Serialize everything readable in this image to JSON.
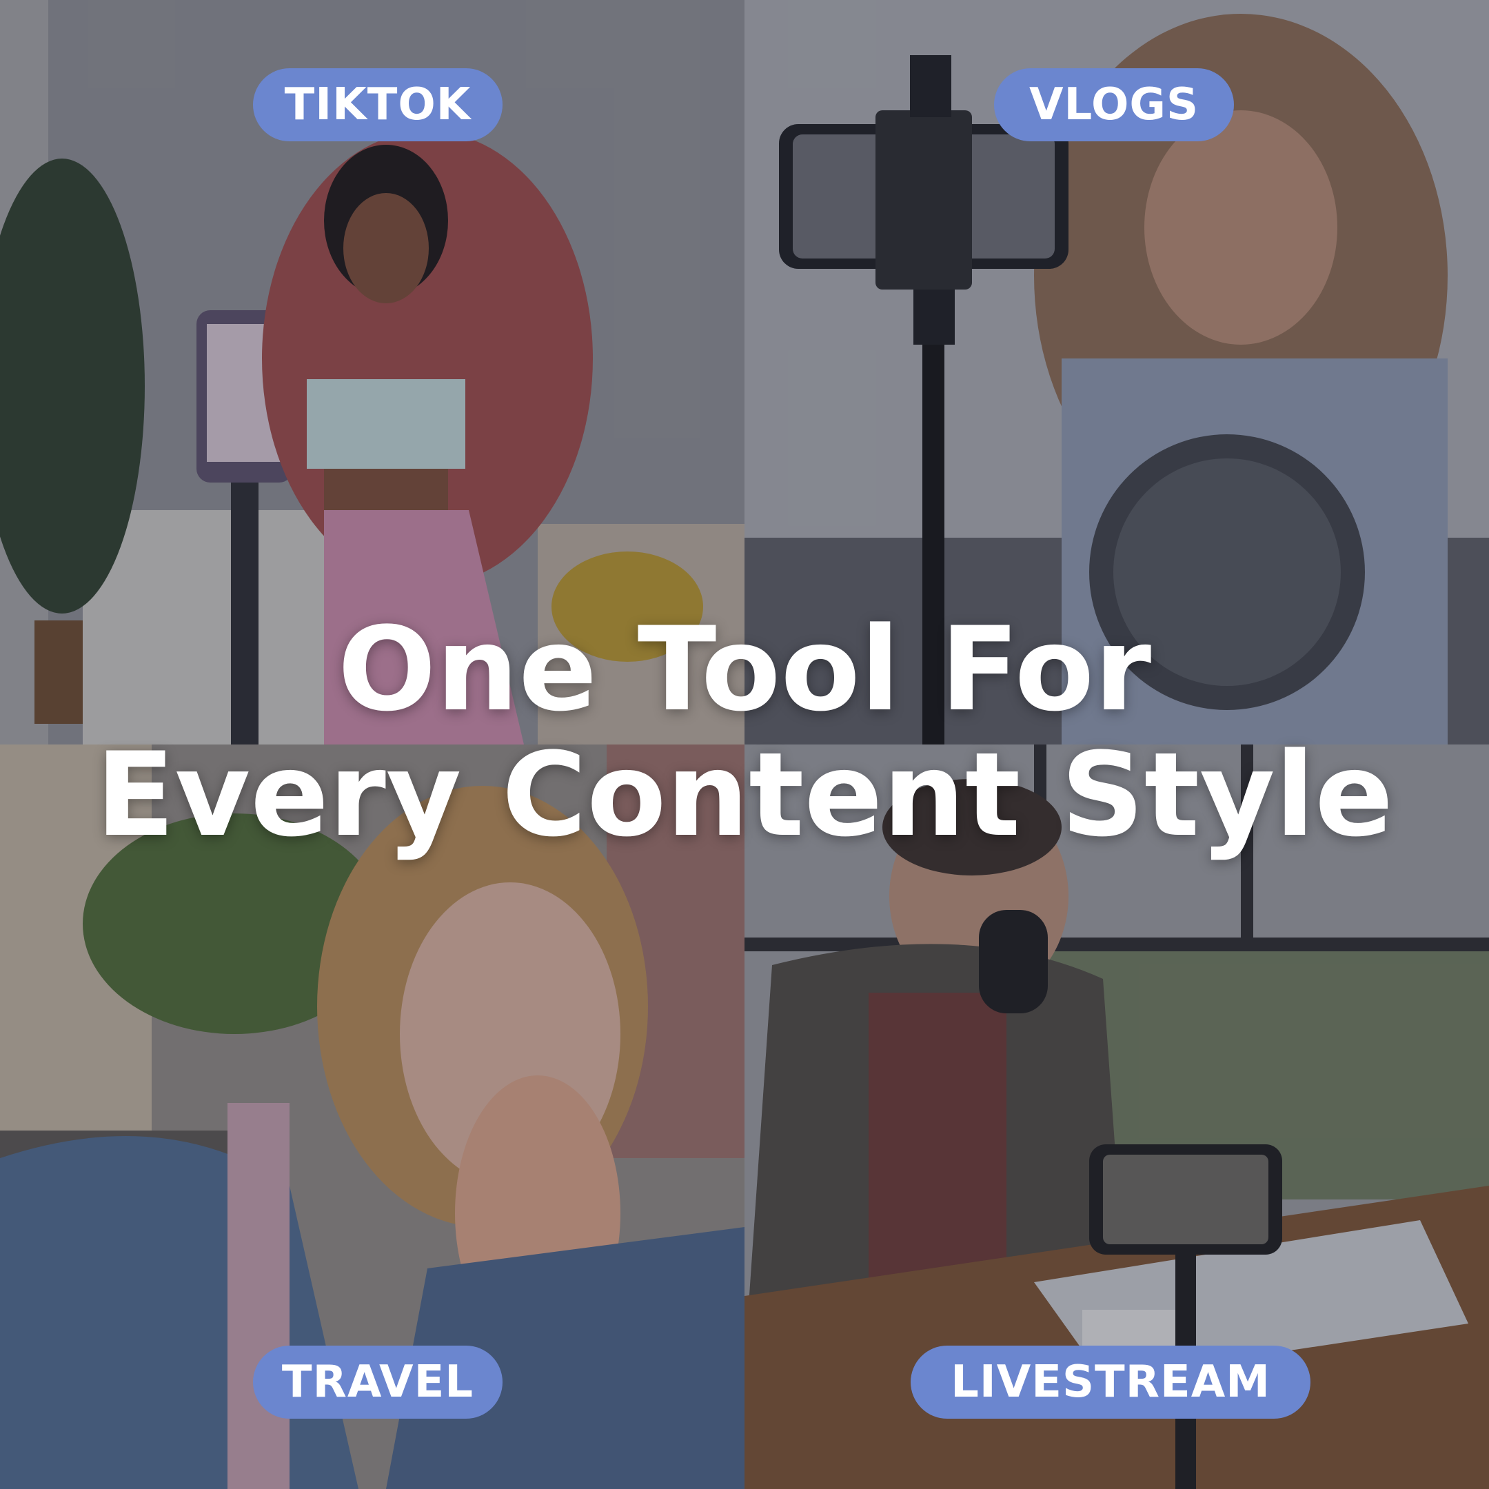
{
  "colors": {
    "pill_bg": "#6b86cf",
    "headline_text": "#ffffff",
    "pill_text": "#ffffff"
  },
  "headline": {
    "line1": "One Tool For",
    "line2": "Every Content Style"
  },
  "tags": {
    "tiktok": "TIKTOK",
    "vlogs": "VLOGS",
    "travel": "TRAVEL",
    "livestream": "LIVESTREAM"
  }
}
